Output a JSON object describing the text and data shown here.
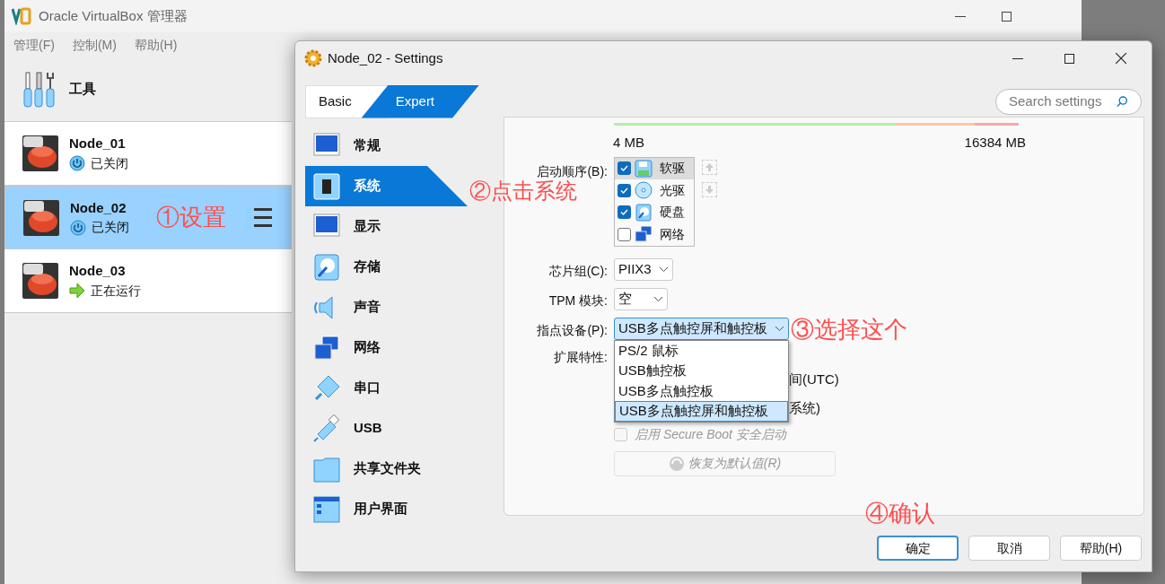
{
  "manager": {
    "title": "Oracle VirtualBox 管理器",
    "menu": [
      "管理(F)",
      "控制(M)",
      "帮助(H)"
    ],
    "tools_label": "工具",
    "vms": [
      {
        "name": "Node_01",
        "status": "已关闭",
        "kind": "off",
        "selected": false
      },
      {
        "name": "Node_02",
        "status": "已关闭",
        "kind": "off",
        "selected": true
      },
      {
        "name": "Node_03",
        "status": "正在运行",
        "kind": "running",
        "selected": false
      }
    ],
    "annotation": "①设置"
  },
  "dialog": {
    "title": "Node_02 - Settings",
    "tabs": [
      {
        "label": "Basic",
        "selected": false
      },
      {
        "label": "Expert",
        "selected": true
      }
    ],
    "search": {
      "placeholder": "Search settings"
    },
    "nav": [
      {
        "label": "常规",
        "kind": "monitor",
        "selected": false
      },
      {
        "label": "系统",
        "kind": "chip",
        "selected": true
      },
      {
        "label": "显示",
        "kind": "display",
        "selected": false
      },
      {
        "label": "存储",
        "kind": "disk",
        "selected": false
      },
      {
        "label": "声音",
        "kind": "speaker",
        "selected": false
      },
      {
        "label": "网络",
        "kind": "network",
        "selected": false
      },
      {
        "label": "串口",
        "kind": "serial",
        "selected": false
      },
      {
        "label": "USB",
        "kind": "usb",
        "selected": false
      },
      {
        "label": "共享文件夹",
        "kind": "folder",
        "selected": false
      },
      {
        "label": "用户界面",
        "kind": "window",
        "selected": false
      }
    ],
    "nav_annotation": "②点击系统",
    "memory": {
      "min_label": "4 MB",
      "max_label": "16384 MB"
    },
    "boot_order": {
      "label": "启动顺序(B):",
      "items": [
        {
          "label": "软驱",
          "kind": "floppy",
          "checked": true,
          "selected": true
        },
        {
          "label": "光驱",
          "kind": "optical",
          "checked": true,
          "selected": false
        },
        {
          "label": "硬盘",
          "kind": "disk",
          "checked": true,
          "selected": false
        },
        {
          "label": "网络",
          "kind": "network",
          "checked": false,
          "selected": false
        }
      ]
    },
    "chipset": {
      "label": "芯片组(C):",
      "value": "PIIX3"
    },
    "tpm": {
      "label": "TPM 模块:",
      "value": "空"
    },
    "pointing": {
      "label": "指点设备(P):",
      "value": "USB多点触控屏和触控板",
      "open": true,
      "options": [
        {
          "label": "PS/2 鼠标",
          "selected": false
        },
        {
          "label": "USB触控板",
          "selected": false
        },
        {
          "label": "USB多点触控板",
          "selected": false
        },
        {
          "label": "USB多点触控屏和触控板",
          "selected": true
        }
      ]
    },
    "pointing_annotation": "③选择这个",
    "extended": {
      "label": "扩展特性:",
      "partial_rows": [
        "间(UTC)",
        "系统)"
      ]
    },
    "secure_boot": {
      "label": "启用 Secure Boot 安全启动",
      "checked": false,
      "disabled": true
    },
    "restore_button": {
      "label": "恢复为默认值(R)",
      "disabled": true
    },
    "buttons_annotation": "④确认",
    "buttons": [
      {
        "label": "确定",
        "default": true
      },
      {
        "label": "取消",
        "default": false
      },
      {
        "label": "帮助(H)",
        "default": false
      }
    ]
  }
}
